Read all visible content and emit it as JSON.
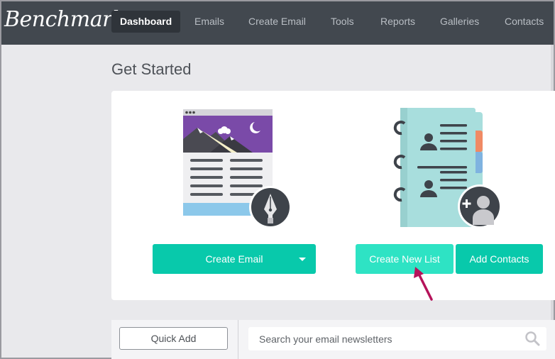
{
  "nav": {
    "logo": "Benchmark",
    "items": [
      {
        "label": "Dashboard",
        "active": true
      },
      {
        "label": "Emails"
      },
      {
        "label": "Create Email"
      },
      {
        "label": "Tools"
      },
      {
        "label": "Reports"
      },
      {
        "label": "Galleries"
      },
      {
        "label": "Contacts"
      }
    ]
  },
  "page_title": "Get Started",
  "actions": {
    "create_email_label": "Create Email",
    "create_list_label": "Create New List",
    "add_contacts_label": "Add Contacts"
  },
  "bottom": {
    "quick_add_label": "Quick Add",
    "search_placeholder": "Search your email newsletters"
  },
  "icons": {
    "email": "email-template-illustration-icon",
    "pen": "fountain-pen-icon",
    "book": "address-book-illustration-icon",
    "add_user": "add-user-icon",
    "search": "search-icon",
    "caret": "chevron-down-icon",
    "arrow": "pointer-arrow-icon"
  },
  "colors": {
    "nav_bg": "#42484f",
    "primary": "#08c9ab",
    "primary_light": "#2ee3c4",
    "arrow": "#b5135a",
    "purple": "#7a4aa8",
    "teal_book": "#a8dedd"
  }
}
